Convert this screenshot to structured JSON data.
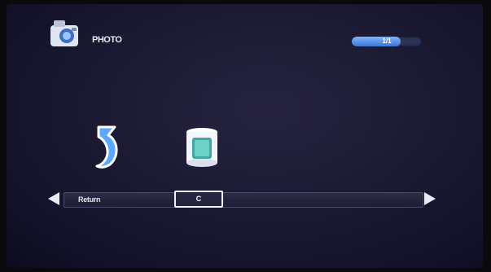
{
  "header": {
    "title": "PHOTO",
    "page_indicator": "1/1",
    "page_progress": 0.7
  },
  "items": [
    {
      "icon": "return-arrow-icon",
      "label": "Return"
    },
    {
      "icon": "folder-drive-icon",
      "label": "C"
    }
  ],
  "colors": {
    "accent": "#3f75d4",
    "background": "#1c1a33",
    "highlight": "#f2f2ff"
  }
}
